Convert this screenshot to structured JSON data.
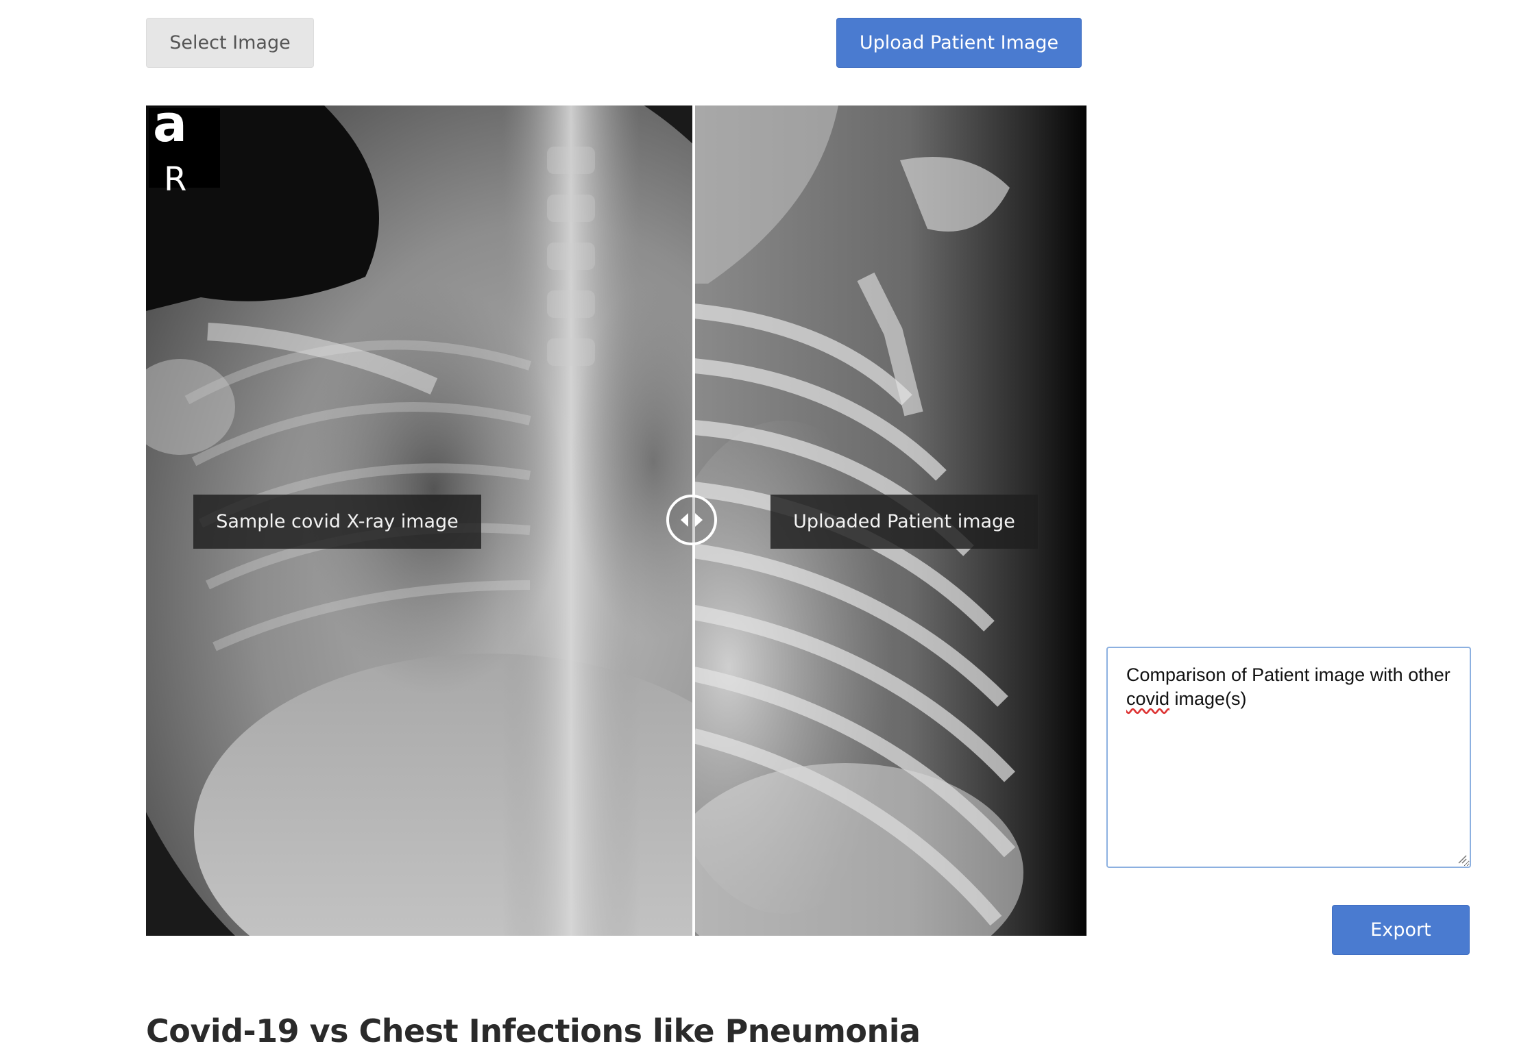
{
  "toolbar": {
    "select_label": "Select Image",
    "upload_label": "Upload Patient Image"
  },
  "viewer": {
    "left_label": "Sample covid X-ray image",
    "right_label": "Uploaded Patient image",
    "marker_letter": "a",
    "marker_side": "R"
  },
  "notes": {
    "text_before": "Comparison of Patient image with other ",
    "text_misspelled": "covid",
    "text_after": " image(s)"
  },
  "actions": {
    "export_label": "Export"
  },
  "section": {
    "title": "Covid-19 vs Chest Infections like Pneumonia"
  },
  "colors": {
    "primary": "#4a7bd0",
    "secondary_button": "#e6e6e6",
    "textarea_border": "#8cb0e0"
  }
}
